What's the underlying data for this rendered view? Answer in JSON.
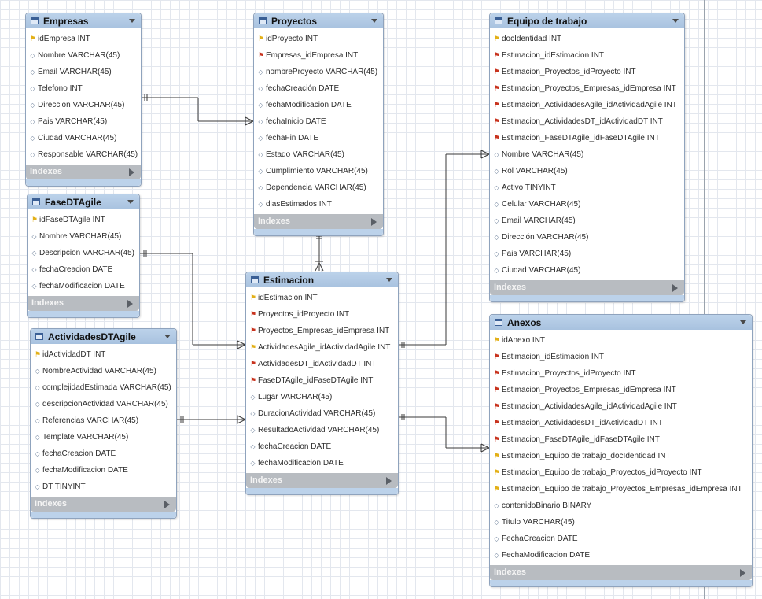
{
  "tables": {
    "empresas": {
      "title": "Empresas",
      "columns": [
        {
          "key": "pk",
          "text": "idEmpresa INT"
        },
        {
          "key": "attr",
          "text": "Nombre VARCHAR(45)"
        },
        {
          "key": "attr",
          "text": "Email VARCHAR(45)"
        },
        {
          "key": "attr",
          "text": "Telefono INT"
        },
        {
          "key": "attr",
          "text": "Direccion VARCHAR(45)"
        },
        {
          "key": "attr",
          "text": "Pais VARCHAR(45)"
        },
        {
          "key": "attr",
          "text": "Ciudad VARCHAR(45)"
        },
        {
          "key": "attr",
          "text": "Responsable VARCHAR(45)"
        }
      ],
      "indexes_label": "Indexes"
    },
    "proyectos": {
      "title": "Proyectos",
      "columns": [
        {
          "key": "pk",
          "text": "idProyecto INT"
        },
        {
          "key": "fk",
          "text": "Empresas_idEmpresa INT"
        },
        {
          "key": "attr",
          "text": "nombreProyecto VARCHAR(45)"
        },
        {
          "key": "attr",
          "text": "fechaCreación DATE"
        },
        {
          "key": "attr",
          "text": "fechaModificacion DATE"
        },
        {
          "key": "attr",
          "text": "fechaInicio DATE"
        },
        {
          "key": "attr",
          "text": "fechaFin DATE"
        },
        {
          "key": "attr",
          "text": "Estado VARCHAR(45)"
        },
        {
          "key": "attr",
          "text": "Cumplimiento VARCHAR(45)"
        },
        {
          "key": "attr",
          "text": "Dependencia VARCHAR(45)"
        },
        {
          "key": "attr",
          "text": "diasEstimados INT"
        }
      ],
      "indexes_label": "Indexes"
    },
    "equipo": {
      "title": "Equipo de trabajo",
      "columns": [
        {
          "key": "pk",
          "text": "docIdentidad INT"
        },
        {
          "key": "fk",
          "text": "Estimacion_idEstimacion INT"
        },
        {
          "key": "fk",
          "text": "Estimacion_Proyectos_idProyecto INT"
        },
        {
          "key": "fk",
          "text": "Estimacion_Proyectos_Empresas_idEmpresa INT"
        },
        {
          "key": "fk",
          "text": "Estimacion_ActividadesAgile_idActividadAgile INT"
        },
        {
          "key": "fk",
          "text": "Estimacion_ActividadesDT_idActividadDT INT"
        },
        {
          "key": "fk",
          "text": "Estimacion_FaseDTAgile_idFaseDTAgile INT"
        },
        {
          "key": "attr",
          "text": "Nombre VARCHAR(45)"
        },
        {
          "key": "attr",
          "text": "Rol VARCHAR(45)"
        },
        {
          "key": "attr",
          "text": "Activo TINYINT"
        },
        {
          "key": "attr",
          "text": "Celular VARCHAR(45)"
        },
        {
          "key": "attr",
          "text": "Email VARCHAR(45)"
        },
        {
          "key": "attr",
          "text": "Dirección VARCHAR(45)"
        },
        {
          "key": "attr",
          "text": "Pais VARCHAR(45)"
        },
        {
          "key": "attr",
          "text": "Ciudad VARCHAR(45)"
        }
      ],
      "indexes_label": "Indexes"
    },
    "fase": {
      "title": "FaseDTAgile",
      "columns": [
        {
          "key": "pk",
          "text": "idFaseDTAgile INT"
        },
        {
          "key": "attr",
          "text": "Nombre VARCHAR(45)"
        },
        {
          "key": "attr",
          "text": "Descripcion VARCHAR(45)"
        },
        {
          "key": "attr",
          "text": "fechaCreacion DATE"
        },
        {
          "key": "attr",
          "text": "fechaModificacion DATE"
        }
      ],
      "indexes_label": "Indexes"
    },
    "estimacion": {
      "title": "Estimacion",
      "columns": [
        {
          "key": "pk",
          "text": "idEstimacion INT"
        },
        {
          "key": "fk",
          "text": "Proyectos_idProyecto INT"
        },
        {
          "key": "fk",
          "text": "Proyectos_Empresas_idEmpresa INT"
        },
        {
          "key": "pk",
          "text": "ActividadesAgile_idActividadAgile INT"
        },
        {
          "key": "fk",
          "text": "ActividadesDT_idActividadDT INT"
        },
        {
          "key": "fk",
          "text": "FaseDTAgile_idFaseDTAgile INT"
        },
        {
          "key": "attr",
          "text": "Lugar VARCHAR(45)"
        },
        {
          "key": "attr",
          "text": "DuracionActividad VARCHAR(45)"
        },
        {
          "key": "attr",
          "text": "ResultadoActividad VARCHAR(45)"
        },
        {
          "key": "attr",
          "text": "fechaCreacion DATE"
        },
        {
          "key": "attr",
          "text": "fechaModificacion DATE"
        }
      ],
      "indexes_label": "Indexes"
    },
    "actividades": {
      "title": "ActividadesDTAgile",
      "columns": [
        {
          "key": "pk",
          "text": "idActividadDT INT"
        },
        {
          "key": "attr",
          "text": "NombreActividad VARCHAR(45)"
        },
        {
          "key": "attr",
          "text": "complejidadEstimada VARCHAR(45)"
        },
        {
          "key": "attr",
          "text": "descripcionActividad VARCHAR(45)"
        },
        {
          "key": "attr",
          "text": "Referencias VARCHAR(45)"
        },
        {
          "key": "attr",
          "text": "Template VARCHAR(45)"
        },
        {
          "key": "attr",
          "text": "fechaCreacion DATE"
        },
        {
          "key": "attr",
          "text": "fechaModificacion DATE"
        },
        {
          "key": "attr",
          "text": "DT TINYINT"
        }
      ],
      "indexes_label": "Indexes"
    },
    "anexos": {
      "title": "Anexos",
      "columns": [
        {
          "key": "pk",
          "text": "idAnexo INT"
        },
        {
          "key": "fk",
          "text": "Estimacion_idEstimacion INT"
        },
        {
          "key": "fk",
          "text": "Estimacion_Proyectos_idProyecto INT"
        },
        {
          "key": "fk",
          "text": "Estimacion_Proyectos_Empresas_idEmpresa INT"
        },
        {
          "key": "fk",
          "text": "Estimacion_ActividadesAgile_idActividadAgile INT"
        },
        {
          "key": "fk",
          "text": "Estimacion_ActividadesDT_idActividadDT INT"
        },
        {
          "key": "fk",
          "text": "Estimacion_FaseDTAgile_idFaseDTAgile INT"
        },
        {
          "key": "pk",
          "text": "Estimacion_Equipo de trabajo_docIdentidad INT"
        },
        {
          "key": "pk",
          "text": "Estimacion_Equipo de trabajo_Proyectos_idProyecto INT"
        },
        {
          "key": "pk",
          "text": "Estimacion_Equipo de trabajo_Proyectos_Empresas_idEmpresa INT"
        },
        {
          "key": "attr",
          "text": "contenidoBinario BINARY"
        },
        {
          "key": "attr",
          "text": "Titulo VARCHAR(45)"
        },
        {
          "key": "attr",
          "text": "FechaCreacion DATE"
        },
        {
          "key": "attr",
          "text": "FechaModificacion DATE"
        }
      ],
      "indexes_label": "Indexes"
    }
  },
  "icons": {
    "pk": "key-icon",
    "fk": "foreign-key-icon",
    "attr": "diamond-icon"
  },
  "colors": {
    "header": "#bcd2ea",
    "footer": "#b8bcc1",
    "pk": "#e3b018",
    "fk": "#c8331e",
    "attr": "#6b7f99"
  }
}
